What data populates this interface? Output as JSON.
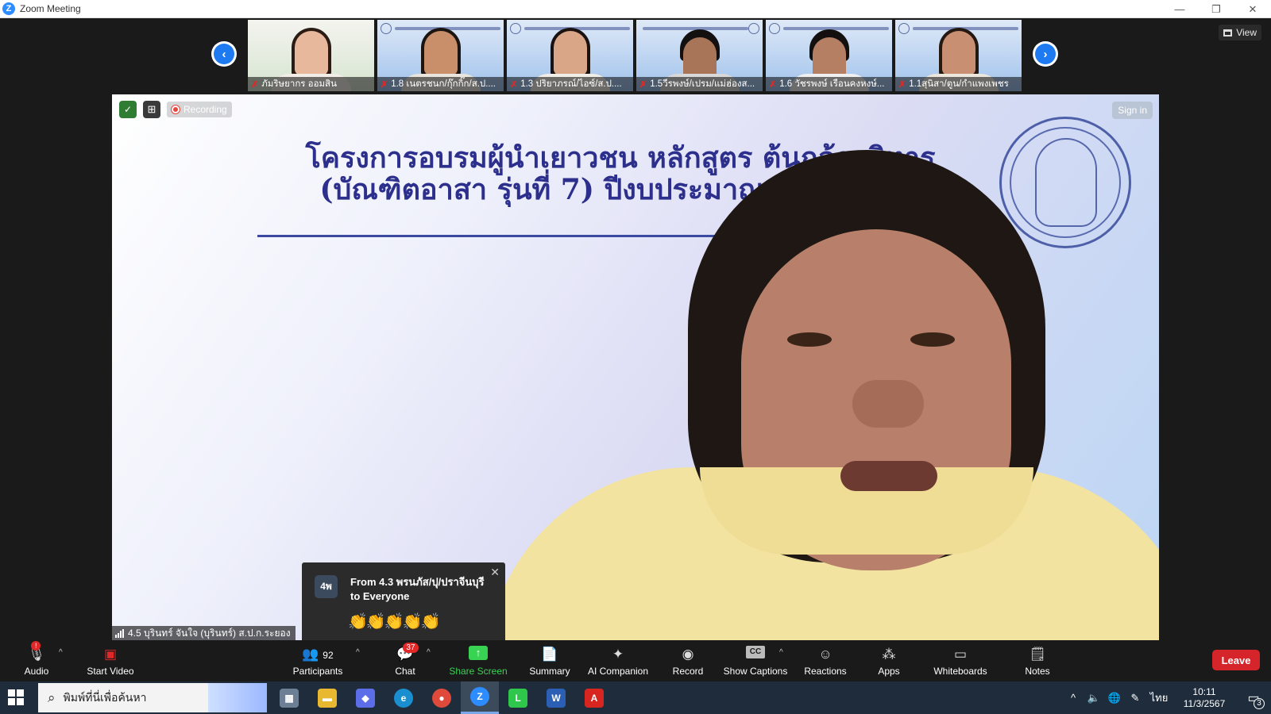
{
  "window": {
    "title": "Zoom Meeting",
    "controls": [
      "—",
      "❐",
      "✕"
    ]
  },
  "gallery": {
    "view_label": "View",
    "thumbnails": [
      {
        "name": "ภัมริษยากร ออมสิน",
        "skin": "#e8b89c",
        "hair": "#3a2418"
      },
      {
        "name": "1.8 เนตรชนก/กุ๊กกิ๊ก/ส.ป....",
        "skin": "#c98f6a",
        "hair": "#1c1410"
      },
      {
        "name": "1.3 ปริยาภรณ์/ไอซ์/ส.ป....",
        "skin": "#d9a687",
        "hair": "#1a1210"
      },
      {
        "name": "1.5วีรพงษ์/เปรม/แม่ฮ่องส...",
        "skin": "#a87558",
        "hair": "#141010"
      },
      {
        "name": "1.6 วัชรพงษ์ เรือนคงหงษ์...",
        "skin": "#b57f63",
        "hair": "#141010"
      },
      {
        "name": "1.1สุนิสา/ตูน/กำแพงเพชร",
        "skin": "#c88f73",
        "hair": "#241812"
      }
    ]
  },
  "meeting": {
    "recording_label": "Recording",
    "sign_in_label": "Sign in",
    "slide_title_line1": "โครงการอบรมผู้นำเยาวชน หลักสูตร ต้นกล้าบริหาร",
    "slide_title_line2": "(บัณฑิตอาสา รุ่นที่ 7) ปีงบประมาณ พ.ศ. 2567",
    "speaker_name": "4.5 บุรินทร์ จันใจ (บุรินทร์) ส.ป.ก.ระยอง"
  },
  "chat_popup": {
    "avatar_text": "4พ",
    "from": "From 4.3 พรนภัส/ปุ/ปราจีนบุรี to Everyone",
    "message": "👏👏👏👏👏"
  },
  "toolbar": {
    "audio": "Audio",
    "start_video": "Start Video",
    "participants": "Participants",
    "participants_count": "92",
    "chat": "Chat",
    "chat_badge": "37",
    "share_screen": "Share Screen",
    "summary": "Summary",
    "ai_companion": "AI Companion",
    "record": "Record",
    "show_captions": "Show Captions",
    "cc": "CC",
    "reactions": "Reactions",
    "apps": "Apps",
    "whiteboards": "Whiteboards",
    "notes": "Notes",
    "leave": "Leave",
    "audio_alert": "!"
  },
  "taskbar": {
    "search_placeholder": "พิมพ์ที่นี่เพื่อค้นหา",
    "language": "ไทย",
    "time": "10:11",
    "date": "11/3/2567",
    "notification_count": "3"
  },
  "colors": {
    "accent": "#2d8cff",
    "leave": "#d5252b",
    "share": "#39d353",
    "muted": "#e02828"
  }
}
